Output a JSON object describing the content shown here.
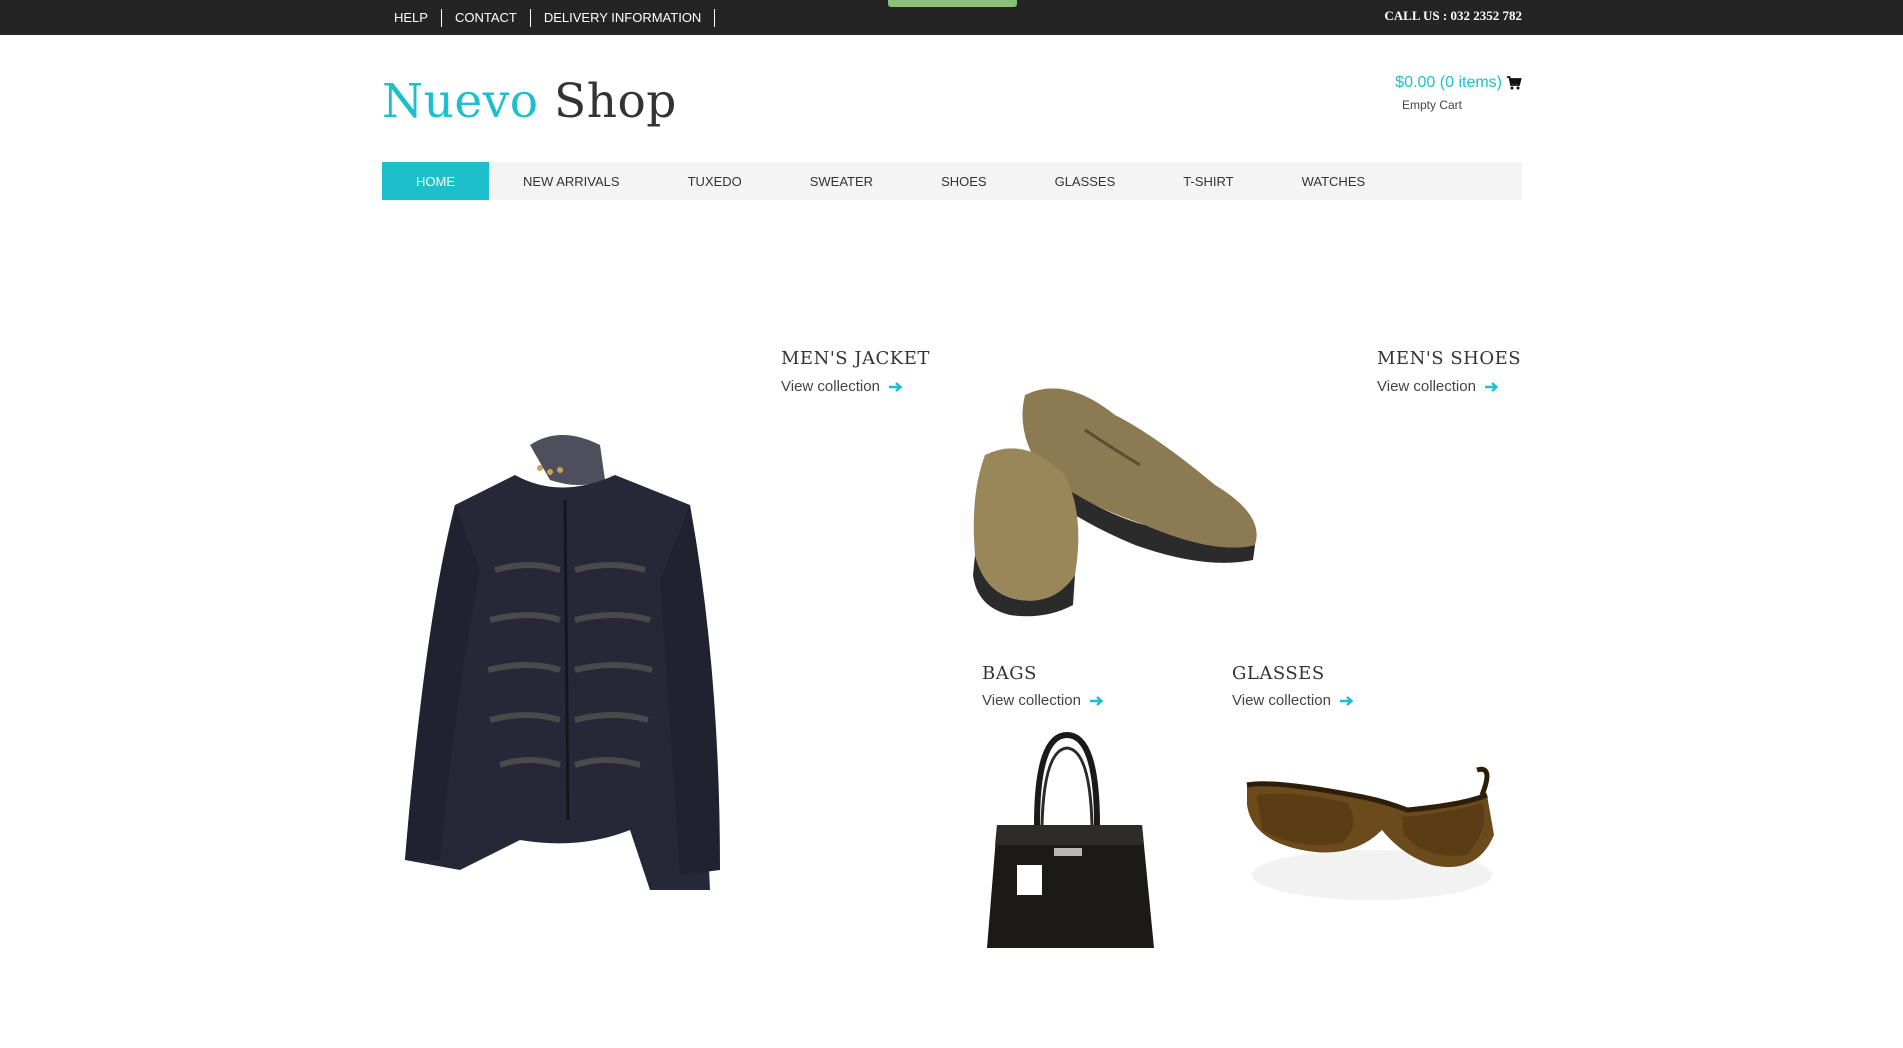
{
  "topbar": {
    "links": [
      "HELP",
      "CONTACT",
      "DELIVERY INFORMATION"
    ],
    "call_us": "CALL US : 032 2352 782"
  },
  "logo": {
    "part1": "Nuevo",
    "part2": "Shop"
  },
  "cart": {
    "total": "$0.00 (0 items)",
    "status": "Empty Cart"
  },
  "nav": {
    "items": [
      "HOME",
      "NEW ARRIVALS",
      "TUXEDO",
      "SWEATER",
      "SHOES",
      "GLASSES",
      "T-SHIRT",
      "WATCHES"
    ],
    "active": "HOME"
  },
  "tiles": {
    "jacket": {
      "title": "MEN'S JACKET",
      "link": "View collection"
    },
    "shoes": {
      "title": "MEN'S SHOES",
      "link": "View collection"
    },
    "bags": {
      "title": "BAGS",
      "link": "View collection"
    },
    "glasses": {
      "title": "GLASSES",
      "link": "View collection"
    }
  },
  "colors": {
    "accent": "#1dbfcb",
    "topbar": "#242424",
    "nav_bg": "#f4f4f4"
  }
}
